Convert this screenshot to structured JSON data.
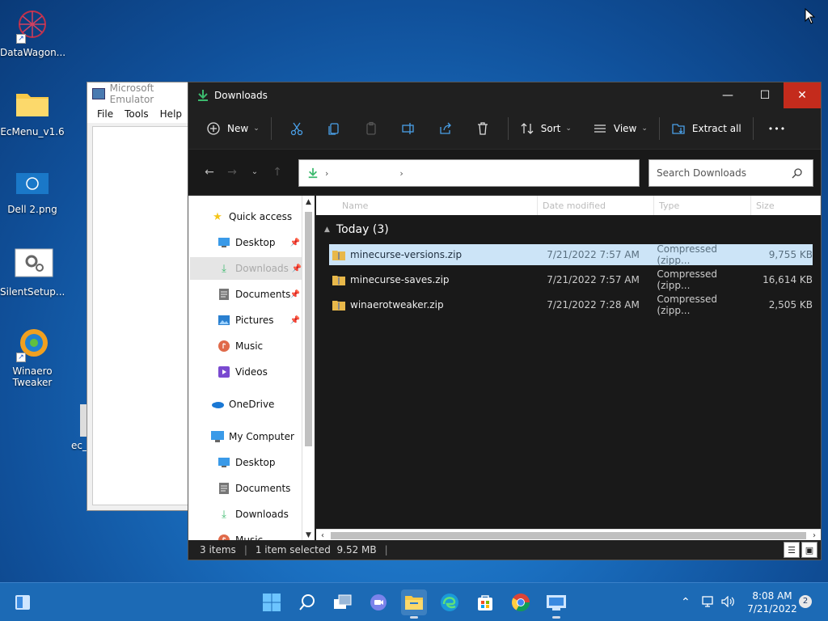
{
  "desktop": {
    "icons": [
      {
        "label": "DataWagon...",
        "icon": "datawagon-icon"
      },
      {
        "label": "EcMenu_v1.6",
        "icon": "folder-icon"
      },
      {
        "label": "Dell 2.png",
        "icon": "image-icon"
      },
      {
        "label": "SilentSetup...",
        "icon": "settings-icon"
      },
      {
        "label": "Winaero Tweaker",
        "icon": "winaero-icon"
      },
      {
        "label": "ec_",
        "icon": "file-icon"
      }
    ]
  },
  "emulator": {
    "title": "Microsoft Emulator",
    "menu": [
      "File",
      "Tools",
      "Help"
    ]
  },
  "explorer": {
    "title": "Downloads",
    "toolbar": {
      "new_label": "New",
      "sort_label": "Sort",
      "view_label": "View",
      "extract_label": "Extract all",
      "more_label": "•••"
    },
    "search_placeholder": "Search Downloads",
    "nav": {
      "quick_access": "Quick access",
      "items": [
        "Desktop",
        "Downloads",
        "Documents",
        "Pictures",
        "Music",
        "Videos"
      ],
      "onedrive": "OneDrive",
      "my_computer": "My Computer",
      "pc_items": [
        "Desktop",
        "Documents",
        "Downloads",
        "Music"
      ]
    },
    "columns": [
      "Name",
      "Date modified",
      "Type",
      "Size"
    ],
    "group": "Today (3)",
    "files": [
      {
        "name": "minecurse-versions.zip",
        "date": "7/21/2022 7:57 AM",
        "type": "Compressed (zipp...",
        "size": "9,755 KB"
      },
      {
        "name": "minecurse-saves.zip",
        "date": "7/21/2022 7:57 AM",
        "type": "Compressed (zipp...",
        "size": "16,614 KB"
      },
      {
        "name": "winaerotweaker.zip",
        "date": "7/21/2022 7:28 AM",
        "type": "Compressed (zipp...",
        "size": "2,505 KB"
      }
    ],
    "status": {
      "count": "3 items",
      "selection": "1 item selected  9.52 MB"
    }
  },
  "taskbar": {
    "time": "8:08 AM",
    "date": "7/21/2022",
    "notifications": "2"
  }
}
